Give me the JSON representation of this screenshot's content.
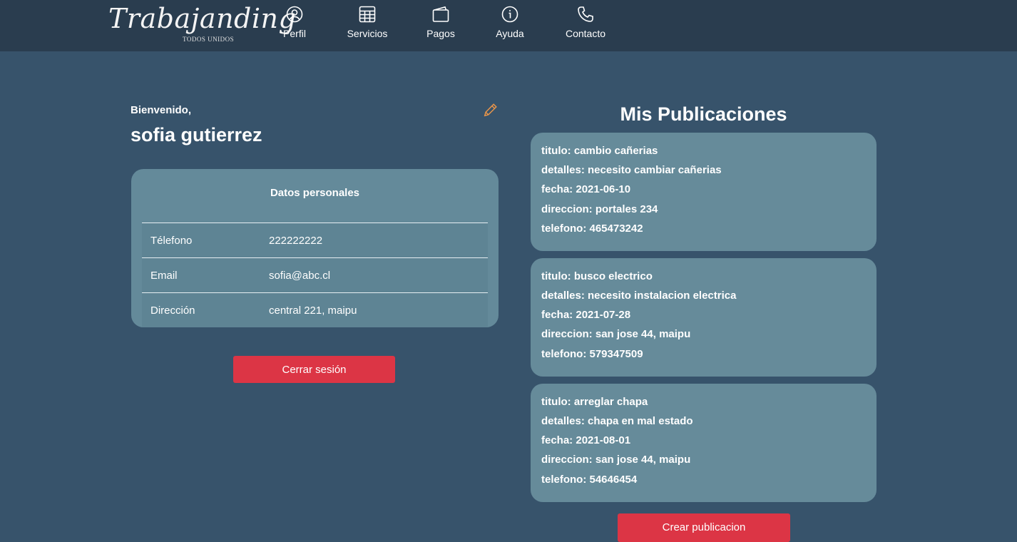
{
  "header": {
    "logo_text": "Trabajanding",
    "logo_subtitle": "TODOS UNIDOS",
    "nav": [
      {
        "label": "Perfil",
        "icon": "person-circle-icon"
      },
      {
        "label": "Servicios",
        "icon": "table-icon"
      },
      {
        "label": "Pagos",
        "icon": "wallet-icon"
      },
      {
        "label": "Ayuda",
        "icon": "info-icon"
      },
      {
        "label": "Contacto",
        "icon": "phone-icon"
      }
    ]
  },
  "profile": {
    "welcome": "Bienvenido,",
    "name": "sofia gutierrez",
    "edit_icon": "pencil-icon",
    "card_title": "Datos personales",
    "rows": [
      {
        "label": "Télefono",
        "value": "222222222"
      },
      {
        "label": "Email",
        "value": "sofia@abc.cl"
      },
      {
        "label": "Dirección",
        "value": "central 221, maipu"
      }
    ],
    "logout_label": "Cerrar sesión"
  },
  "publications": {
    "title": "Mis Publicaciones",
    "items": [
      {
        "titulo": "titulo: cambio cañerias",
        "detalles": "detalles: necesito cambiar cañerias",
        "fecha": "fecha: 2021-06-10",
        "direccion": "direccion: portales 234",
        "telefono": "telefono: 465473242"
      },
      {
        "titulo": "titulo: busco electrico",
        "detalles": "detalles: necesito instalacion electrica",
        "fecha": "fecha: 2021-07-28",
        "direccion": "direccion: san jose 44, maipu",
        "telefono": "telefono: 579347509"
      },
      {
        "titulo": "titulo: arreglar chapa",
        "detalles": "detalles: chapa en mal estado",
        "fecha": "fecha: 2021-08-01",
        "direccion": "direccion: san jose 44, maipu",
        "telefono": "telefono: 54646454"
      }
    ],
    "create_label": "Crear publicacion"
  },
  "colors": {
    "page_background": "#37536b",
    "header_background": "#2a3d4f",
    "card_background": "#668b9a",
    "button_red": "#dc3545",
    "edit_icon_orange": "#e8954a"
  }
}
